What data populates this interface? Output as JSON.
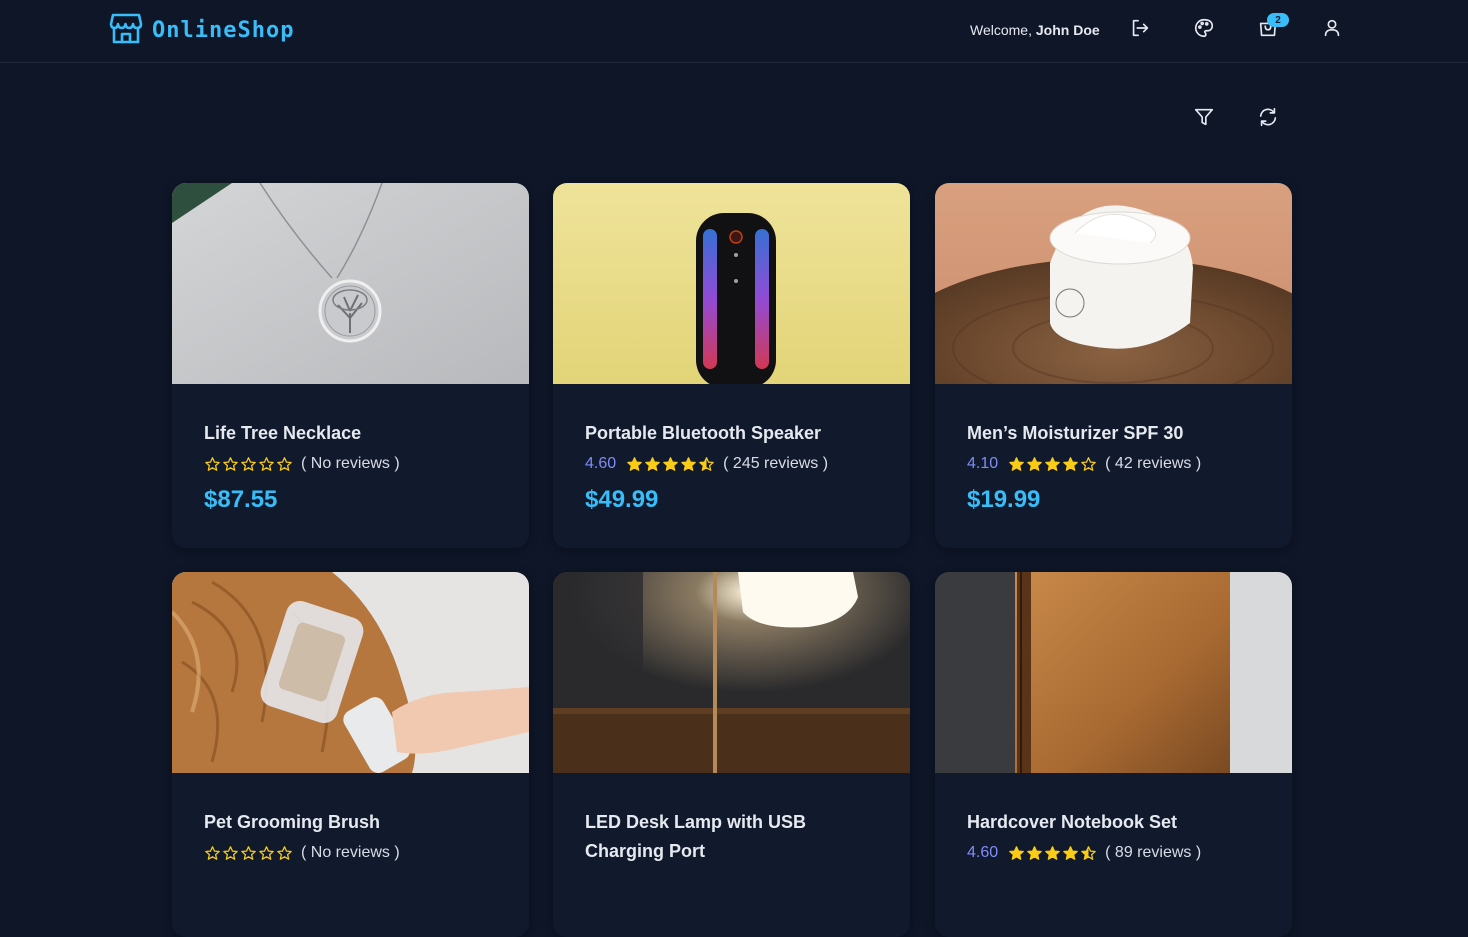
{
  "header": {
    "logo_text": "OnlineShop",
    "welcome_prefix": "Welcome, ",
    "user_name": "John Doe",
    "cart_count": "2",
    "icons": [
      "store-icon",
      "logout-icon",
      "palette-icon",
      "cart-icon",
      "user-icon"
    ]
  },
  "toolbar": {
    "icons": [
      "filter-icon",
      "refresh-icon"
    ]
  },
  "colors": {
    "background": "#0e1628",
    "card": "#111a2d",
    "accent": "#38bdf8",
    "rating": "#818cf8",
    "star": "#facc15"
  },
  "products": [
    {
      "name": "Life Tree Necklace",
      "rating": "",
      "stars": 0,
      "reviews": "( No reviews )",
      "price": "$87.55"
    },
    {
      "name": "Portable Bluetooth Speaker",
      "rating": "4.60",
      "stars": 4.6,
      "reviews": "( 245 reviews )",
      "price": "$49.99"
    },
    {
      "name": "Men’s Moisturizer SPF 30",
      "rating": "4.10",
      "stars": 4.1,
      "reviews": "( 42 reviews )",
      "price": "$19.99"
    },
    {
      "name": "Pet Grooming Brush",
      "rating": "",
      "stars": 0,
      "reviews": "( No reviews )",
      "price": ""
    },
    {
      "name": "LED Desk Lamp with USB Charging Port",
      "rating": "",
      "stars": null,
      "reviews": "",
      "price": ""
    },
    {
      "name": "Hardcover Notebook Set",
      "rating": "4.60",
      "stars": 4.6,
      "reviews": "( 89 reviews )",
      "price": ""
    }
  ]
}
